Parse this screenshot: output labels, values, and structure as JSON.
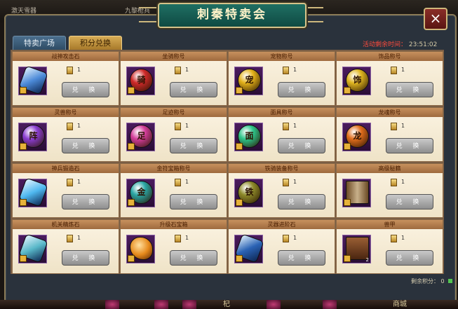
{
  "top_strip": {
    "left_text": "激天雪器",
    "center_text": "九黎枪兵"
  },
  "window": {
    "title": "刺秦特卖会",
    "close_icon": "×"
  },
  "tabs": [
    {
      "label": "特卖广场"
    },
    {
      "label": "积分兑换"
    }
  ],
  "timer": {
    "label": "活动剩余时间：",
    "value": "23:51:02"
  },
  "exchange_label": "兑 换",
  "cards": [
    {
      "title": "战神攻击石",
      "cost": "1",
      "icon": "crystal",
      "color": "#4c8ad8",
      "glyph": "",
      "count": ""
    },
    {
      "title": "坐骑称号",
      "cost": "1",
      "icon": "orb",
      "color": "#cf2a2a",
      "glyph": "骑",
      "count": ""
    },
    {
      "title": "宠物称号",
      "cost": "1",
      "icon": "orb",
      "color": "#e4b21a",
      "glyph": "宠",
      "count": ""
    },
    {
      "title": "饰品称号",
      "cost": "1",
      "icon": "orb",
      "color": "#dfb520",
      "glyph": "饰",
      "count": ""
    },
    {
      "title": "灵兽称号",
      "cost": "1",
      "icon": "orb",
      "color": "#8b3dd1",
      "glyph": "阵",
      "count": ""
    },
    {
      "title": "足迹称号",
      "cost": "1",
      "icon": "orb",
      "color": "#d33d9a",
      "glyph": "足",
      "count": ""
    },
    {
      "title": "面具称号",
      "cost": "1",
      "icon": "orb",
      "color": "#2ec58a",
      "glyph": "面",
      "count": ""
    },
    {
      "title": "龙魂称号",
      "cost": "1",
      "icon": "orb",
      "color": "#e06d1c",
      "glyph": "龙",
      "count": ""
    },
    {
      "title": "神兵锻造石",
      "cost": "1",
      "icon": "crystal",
      "color": "#4fb8ef",
      "glyph": "",
      "count": ""
    },
    {
      "title": "金符宝箱称号",
      "cost": "1",
      "icon": "orb",
      "color": "#2aa6a4",
      "glyph": "金",
      "count": ""
    },
    {
      "title": "铁骑装备称号",
      "cost": "1",
      "icon": "orb",
      "color": "#8d8a2a",
      "glyph": "铁",
      "count": ""
    },
    {
      "title": "高级秘籍",
      "cost": "1",
      "icon": "scroll",
      "color": "#c8b08a",
      "glyph": "",
      "count": ""
    },
    {
      "title": "机关精炼石",
      "cost": "1",
      "icon": "crystal",
      "color": "#59b8c9",
      "glyph": "",
      "count": ""
    },
    {
      "title": "升级石宝箱",
      "cost": "1",
      "icon": "stone",
      "color": "#e68a1c",
      "glyph": "",
      "count": ""
    },
    {
      "title": "灵器进阶石",
      "cost": "1",
      "icon": "crystal",
      "color": "#2b63b5",
      "glyph": "",
      "count": ""
    },
    {
      "title": "兽甲",
      "cost": "1",
      "icon": "book",
      "color": "#9a5f34",
      "glyph": "",
      "count": "2"
    }
  ],
  "score": {
    "label": "剩余积分：",
    "value": "0"
  },
  "bottom_bar": {
    "text_1": "杞",
    "text_2": "商城"
  }
}
